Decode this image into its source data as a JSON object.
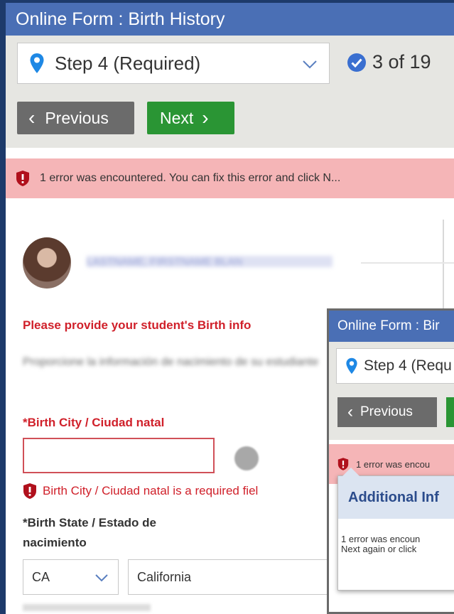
{
  "header": {
    "title": "Online Form : Birth History"
  },
  "toolbar": {
    "step_label": "Step 4 (Required)",
    "progress_text": "3 of 19",
    "previous_label": "Previous",
    "next_label": "Next"
  },
  "error_banner": {
    "message": "1 error was encountered. You can fix this error and click N..."
  },
  "student": {
    "name": "LASTNAME, FIRSTNAME BLAN"
  },
  "form": {
    "prompt": "Please provide your student's Birth info",
    "instructions_es": "Proporcione la información de nacimiento de su estudiante",
    "birth_city_label": "*Birth City / Ciudad natal",
    "birth_city_value": "",
    "birth_city_error": "Birth City / Ciudad natal is a required fiel",
    "birth_state_label_line1": "*Birth State / Estado de",
    "birth_state_label_line2": "nacimiento",
    "state_code": "CA",
    "state_name": "California"
  },
  "inset": {
    "title": "Online Form : Bir",
    "step_label": "Step 4 (Requ",
    "previous_label": "Previous",
    "error_text": "1 error was encou",
    "dialog_title": "Additional Inf",
    "dialog_line1": "1 error was encoun",
    "dialog_line2": "Next again or click"
  },
  "colors": {
    "header_bg": "#4a6fb5",
    "next_button": "#2a9534",
    "previous_button": "#6b6b6b",
    "error_banner_bg": "#f5b5b7",
    "error_text": "#d0202a",
    "accent_blue": "#1e88e5"
  },
  "icons": [
    "location-pin-icon",
    "chevron-down-icon",
    "check-circle-icon",
    "chevron-left-icon",
    "chevron-right-icon",
    "error-shield-icon"
  ]
}
